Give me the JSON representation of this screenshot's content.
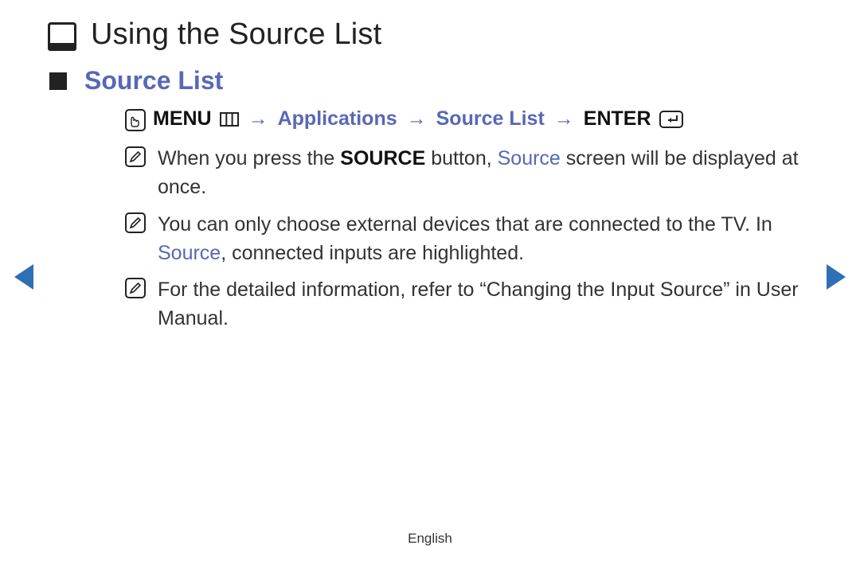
{
  "title": "Using the Source List",
  "subtitle": "Source List",
  "navpath": {
    "menu_label": "MENU",
    "arrow": "→",
    "applications": "Applications",
    "source_list": "Source List",
    "enter_label": "ENTER"
  },
  "notes": [
    {
      "pre": "When you press the ",
      "bold1": "SOURCE",
      "mid1": " button, ",
      "blue1": "Source",
      "post": " screen will be displayed at once."
    },
    {
      "pre": "You can only choose external devices that are connected to the TV. In ",
      "blue1": "Source",
      "post": ", connected inputs are highlighted."
    },
    {
      "pre": "For the detailed information, refer to “Changing the Input Source” in User Manual."
    }
  ],
  "footer_language": "English"
}
